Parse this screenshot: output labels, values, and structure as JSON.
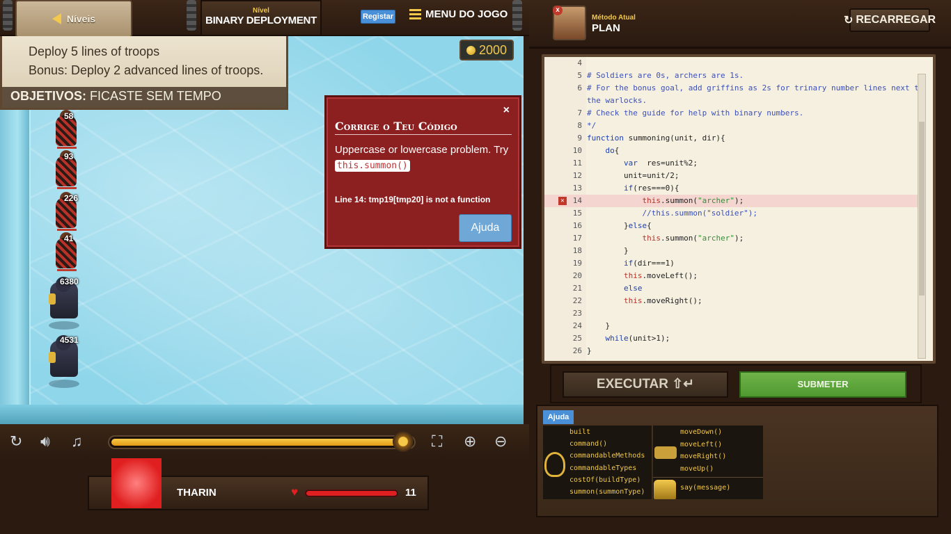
{
  "header": {
    "levels_label": "Níveis",
    "level_caption": "Nível",
    "level_name": "BINARY DEPLOYMENT",
    "register_label": "Registar",
    "menu_label": "MENU DO JOGO"
  },
  "objectives": {
    "goals": [
      "Deploy 5 lines of troops",
      "Bonus: Deploy 2 advanced lines of troops."
    ],
    "status_prefix": "OBJETIVOS:",
    "status_text": "FICASTE SEM TEMPO"
  },
  "gold": "2000",
  "units": [
    {
      "label": "58",
      "type": "soldier"
    },
    {
      "label": "93",
      "type": "soldier"
    },
    {
      "label": "226",
      "type": "soldier"
    },
    {
      "label": "41",
      "type": "soldier"
    },
    {
      "label": "6380",
      "type": "warlock"
    },
    {
      "label": "4531",
      "type": "warlock"
    }
  ],
  "error_popup": {
    "close": "×",
    "title": "Corrige o Teu Código",
    "message": "Uppercase or lowercase problem. Try",
    "suggestion": "this.summon()",
    "line_error": "Line 14: tmp19[tmp20] is not a function",
    "help_label": "Ajuda"
  },
  "controls": {
    "progress": 0.97,
    "restart_icon": "restart-icon",
    "volume_icon": "volume-icon",
    "music_icon": "music-icon",
    "fullscreen_icon": "fullscreen-icon",
    "zoom_in_icon": "zoom-in-icon",
    "zoom_out_icon": "zoom-out-icon"
  },
  "hero": {
    "name": "THARIN",
    "health": "11",
    "health_fraction": 1.0
  },
  "method": {
    "caption": "Método Atual",
    "value": "PLAN",
    "reload_label": "RECARREGAR"
  },
  "code": {
    "lines": [
      {
        "n": "4",
        "text": "",
        "type": "comment"
      },
      {
        "n": "5",
        "text": "# Soldiers are 0s, archers are 1s.",
        "type": "comment"
      },
      {
        "n": "6",
        "text": "# For the bonus goal, add griffins as 2s for trinary number lines next to",
        "type": "comment"
      },
      {
        "n": "",
        "text": "the warlocks.",
        "type": "comment"
      },
      {
        "n": "7",
        "text": "# Check the guide for help with binary numbers.",
        "type": "comment"
      },
      {
        "n": "8",
        "text": "*/",
        "type": "comment"
      },
      {
        "n": "9",
        "text": "function summoning(unit, dir){",
        "type": "code"
      },
      {
        "n": "10",
        "text": "    do{",
        "type": "code"
      },
      {
        "n": "11",
        "text": "        var  res=unit%2;",
        "type": "code"
      },
      {
        "n": "12",
        "text": "        unit=unit/2;",
        "type": "code"
      },
      {
        "n": "13",
        "text": "        if(res===0){",
        "type": "code"
      },
      {
        "n": "14",
        "text": "            this.summon(\"archer\");",
        "type": "error"
      },
      {
        "n": "15",
        "text": "            //this.summon(\"soldier\");",
        "type": "comment"
      },
      {
        "n": "16",
        "text": "        }else{",
        "type": "code"
      },
      {
        "n": "17",
        "text": "            this.summon(\"archer\");",
        "type": "code"
      },
      {
        "n": "18",
        "text": "        }",
        "type": "code"
      },
      {
        "n": "19",
        "text": "        if(dir===1)",
        "type": "code"
      },
      {
        "n": "20",
        "text": "        this.moveLeft();",
        "type": "code"
      },
      {
        "n": "21",
        "text": "        else",
        "type": "code"
      },
      {
        "n": "22",
        "text": "        this.moveRight();",
        "type": "code"
      },
      {
        "n": "23",
        "text": "",
        "type": "code"
      },
      {
        "n": "24",
        "text": "    }",
        "type": "code"
      },
      {
        "n": "25",
        "text": "    while(unit>1);",
        "type": "code"
      },
      {
        "n": "26",
        "text": "}",
        "type": "code"
      }
    ]
  },
  "actions": {
    "run_label": "EXECUTAR ⇧↵",
    "submit_label": "SUBMETER"
  },
  "palette": {
    "help_tab": "Ajuda",
    "left_items": [
      "built",
      "command()",
      "commandableMethods",
      "commandableTypes",
      "costOf(buildType)",
      "summon(summonType)"
    ],
    "right_top_items": [
      "moveDown()",
      "moveLeft()",
      "moveRight()",
      "moveUp()"
    ],
    "right_bottom_items": [
      "say(message)"
    ]
  },
  "colors": {
    "error_red": "#8c1f1f",
    "gold": "#f2c94c",
    "submit_green": "#5aa53a",
    "ice": "#8fd6ea"
  }
}
